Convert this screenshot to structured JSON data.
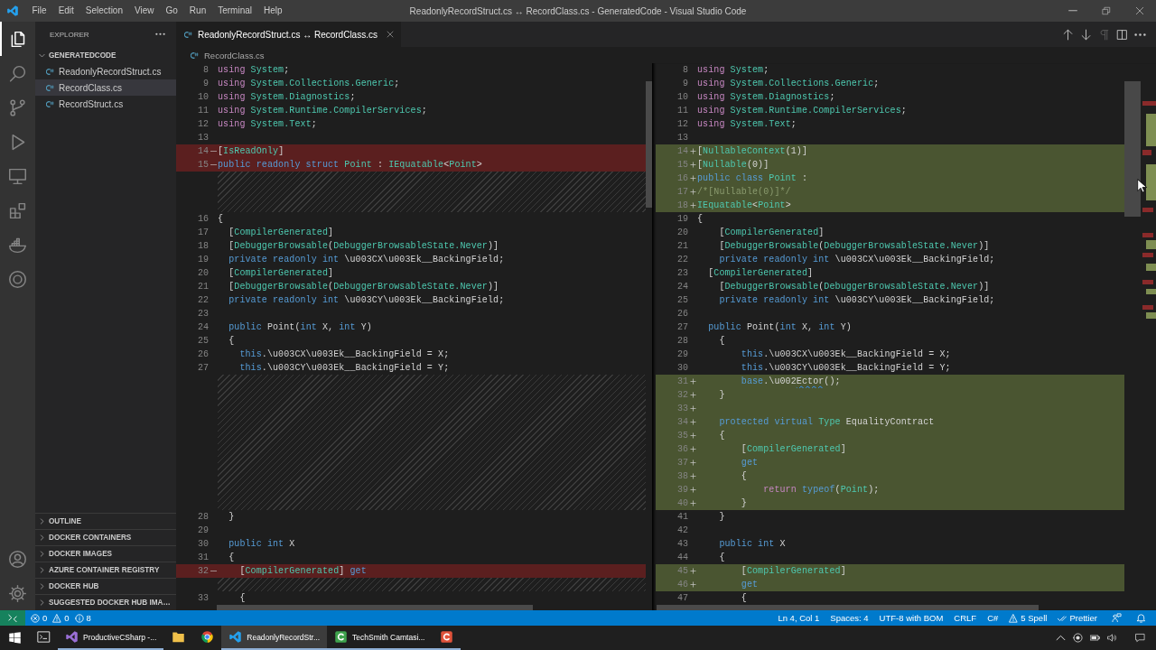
{
  "title_bar": {
    "menu": [
      "File",
      "Edit",
      "Selection",
      "View",
      "Go",
      "Run",
      "Terminal",
      "Help"
    ],
    "title": "ReadonlyRecordStruct.cs ↔ RecordClass.cs - GeneratedCode - Visual Studio Code"
  },
  "activity_bar": {
    "items": [
      {
        "kind": "files",
        "selected": true
      },
      {
        "kind": "search",
        "selected": false
      },
      {
        "kind": "source-control",
        "selected": false
      },
      {
        "kind": "run",
        "selected": false
      },
      {
        "kind": "remote",
        "selected": false
      },
      {
        "kind": "extensions",
        "selected": false
      },
      {
        "kind": "docker",
        "selected": false
      },
      {
        "kind": "ring",
        "selected": false
      }
    ]
  },
  "sidebar": {
    "title": "EXPLORER",
    "folder": {
      "name": "GENERATEDCODE",
      "expanded": true,
      "files": [
        {
          "name": "ReadonlyRecordStruct.cs",
          "selected": false
        },
        {
          "name": "RecordClass.cs",
          "selected": true
        },
        {
          "name": "RecordStruct.cs",
          "selected": false
        }
      ]
    },
    "sections": [
      {
        "name": "OUTLINE",
        "expanded": false
      },
      {
        "name": "DOCKER CONTAINERS",
        "expanded": false
      },
      {
        "name": "DOCKER IMAGES",
        "expanded": false
      },
      {
        "name": "AZURE CONTAINER REGISTRY",
        "expanded": false
      },
      {
        "name": "DOCKER HUB",
        "expanded": false
      },
      {
        "name": "SUGGESTED DOCKER HUB IMA…",
        "expanded": false
      }
    ]
  },
  "editor": {
    "tabs": [
      {
        "label": "ReadonlyRecordStruct.cs ↔ RecordClass.cs",
        "selected": true
      }
    ],
    "actions": [
      {
        "kind": "up",
        "disabled": false
      },
      {
        "kind": "down",
        "disabled": false
      },
      {
        "kind": "whitespace",
        "disabled": true
      },
      {
        "kind": "split",
        "disabled": false
      },
      {
        "kind": "more",
        "disabled": false
      }
    ],
    "breadcrumb": "RecordClass.cs",
    "panes": [
      {
        "lines": [
          {
            "number": "8",
            "kind": "unchanged",
            "tokens": [
              {
                "kind": "ctl",
                "text": "using"
              },
              {
                "kind": "type",
                "text": " System"
              },
              {
                "kind": "plain",
                "text": ";"
              }
            ]
          },
          {
            "number": "9",
            "kind": "unchanged",
            "tokens": [
              {
                "kind": "ctl",
                "text": "using"
              },
              {
                "kind": "type",
                "text": " System.Collections.Generic"
              },
              {
                "kind": "plain",
                "text": ";"
              }
            ]
          },
          {
            "number": "10",
            "kind": "unchanged",
            "tokens": [
              {
                "kind": "ctl",
                "text": "using"
              },
              {
                "kind": "type",
                "text": " System.Diagnostics"
              },
              {
                "kind": "plain",
                "text": ";"
              }
            ]
          },
          {
            "number": "11",
            "kind": "unchanged",
            "tokens": [
              {
                "kind": "ctl",
                "text": "using"
              },
              {
                "kind": "type",
                "text": " System.Runtime.CompilerServices"
              },
              {
                "kind": "plain",
                "text": ";"
              }
            ]
          },
          {
            "number": "12",
            "kind": "unchanged",
            "tokens": [
              {
                "kind": "ctl",
                "text": "using"
              },
              {
                "kind": "type",
                "text": " System.Text"
              },
              {
                "kind": "plain",
                "text": ";"
              }
            ]
          },
          {
            "number": "13",
            "kind": "unchanged"
          },
          {
            "number": "14",
            "kind": "removed",
            "tokens": [
              {
                "kind": "plain",
                "text": "["
              },
              {
                "kind": "type",
                "text": "IsReadOnly"
              },
              {
                "kind": "plain",
                "text": "]"
              }
            ]
          },
          {
            "number": "15",
            "kind": "removed",
            "tokens": [
              {
                "kind": "kw",
                "text": "public readonly struct"
              },
              {
                "kind": "type",
                "text": " Point"
              },
              {
                "kind": "plain",
                "text": " : "
              },
              {
                "kind": "type",
                "text": "IEquatable"
              },
              {
                "kind": "plain",
                "text": "<"
              },
              {
                "kind": "type",
                "text": "Point"
              },
              {
                "kind": "plain",
                "text": ">"
              }
            ]
          },
          {
            "kind": "filler"
          },
          {
            "kind": "filler"
          },
          {
            "kind": "filler"
          },
          {
            "number": "16",
            "kind": "unchanged",
            "tokens": [
              {
                "kind": "plain",
                "text": "{"
              }
            ]
          },
          {
            "number": "17",
            "kind": "unchanged",
            "tokens": [
              {
                "kind": "plain",
                "text": "  ["
              },
              {
                "kind": "type",
                "text": "CompilerGenerated"
              },
              {
                "kind": "plain",
                "text": "]"
              }
            ]
          },
          {
            "number": "18",
            "kind": "unchanged",
            "tokens": [
              {
                "kind": "plain",
                "text": "  ["
              },
              {
                "kind": "type",
                "text": "DebuggerBrowsable"
              },
              {
                "kind": "plain",
                "text": "("
              },
              {
                "kind": "type",
                "text": "DebuggerBrowsableState.Never"
              },
              {
                "kind": "plain",
                "text": ")]"
              }
            ]
          },
          {
            "number": "19",
            "kind": "unchanged",
            "tokens": [
              {
                "kind": "kw",
                "text": "  private readonly int"
              },
              {
                "kind": "plain",
                "text": " \\u003CX\\u003Ek__BackingField;"
              }
            ]
          },
          {
            "number": "20",
            "kind": "unchanged",
            "tokens": [
              {
                "kind": "plain",
                "text": "  ["
              },
              {
                "kind": "type",
                "text": "CompilerGenerated"
              },
              {
                "kind": "plain",
                "text": "]"
              }
            ]
          },
          {
            "number": "21",
            "kind": "unchanged",
            "tokens": [
              {
                "kind": "plain",
                "text": "  ["
              },
              {
                "kind": "type",
                "text": "DebuggerBrowsable"
              },
              {
                "kind": "plain",
                "text": "("
              },
              {
                "kind": "type",
                "text": "DebuggerBrowsableState.Never"
              },
              {
                "kind": "plain",
                "text": ")]"
              }
            ]
          },
          {
            "number": "22",
            "kind": "unchanged",
            "tokens": [
              {
                "kind": "kw",
                "text": "  private readonly int"
              },
              {
                "kind": "plain",
                "text": " \\u003CY\\u003Ek__BackingField;"
              }
            ]
          },
          {
            "number": "23",
            "kind": "unchanged"
          },
          {
            "number": "24",
            "kind": "unchanged",
            "tokens": [
              {
                "kind": "kw",
                "text": "  public"
              },
              {
                "kind": "plain",
                "text": " Point("
              },
              {
                "kind": "kw",
                "text": "int"
              },
              {
                "kind": "plain",
                "text": " X, "
              },
              {
                "kind": "kw",
                "text": "int"
              },
              {
                "kind": "plain",
                "text": " Y)"
              }
            ]
          },
          {
            "number": "25",
            "kind": "unchanged",
            "tokens": [
              {
                "kind": "plain",
                "text": "  {"
              }
            ]
          },
          {
            "number": "26",
            "kind": "unchanged",
            "tokens": [
              {
                "kind": "kw",
                "text": "    this"
              },
              {
                "kind": "plain",
                "text": ".\\u003CX\\u003Ek__BackingField = X;"
              }
            ]
          },
          {
            "number": "27",
            "kind": "unchanged",
            "tokens": [
              {
                "kind": "kw",
                "text": "    this"
              },
              {
                "kind": "plain",
                "text": ".\\u003CY\\u003Ek__BackingField = Y;"
              }
            ]
          },
          {
            "kind": "filler"
          },
          {
            "kind": "filler"
          },
          {
            "kind": "filler"
          },
          {
            "kind": "filler"
          },
          {
            "kind": "filler"
          },
          {
            "kind": "filler"
          },
          {
            "kind": "filler"
          },
          {
            "kind": "filler"
          },
          {
            "kind": "filler"
          },
          {
            "kind": "filler"
          },
          {
            "number": "28",
            "kind": "unchanged",
            "tokens": [
              {
                "kind": "plain",
                "text": "  }"
              }
            ]
          },
          {
            "number": "29",
            "kind": "unchanged"
          },
          {
            "number": "30",
            "kind": "unchanged",
            "tokens": [
              {
                "kind": "kw",
                "text": "  public int"
              },
              {
                "kind": "plain",
                "text": " X"
              }
            ]
          },
          {
            "number": "31",
            "kind": "unchanged",
            "tokens": [
              {
                "kind": "plain",
                "text": "  {"
              }
            ]
          },
          {
            "number": "32",
            "kind": "removed",
            "tokens": [
              {
                "kind": "plain",
                "text": "    ["
              },
              {
                "kind": "type",
                "text": "CompilerGenerated"
              },
              {
                "kind": "plain",
                "text": "] "
              },
              {
                "kind": "kw",
                "text": "get"
              }
            ]
          },
          {
            "kind": "filler"
          },
          {
            "number": "33",
            "kind": "unchanged",
            "tokens": [
              {
                "kind": "plain",
                "text": "    {"
              }
            ]
          }
        ]
      },
      {
        "lines": [
          {
            "number": "8",
            "kind": "unchanged",
            "tokens": [
              {
                "kind": "ctl",
                "text": "using"
              },
              {
                "kind": "type",
                "text": " System"
              },
              {
                "kind": "plain",
                "text": ";"
              }
            ]
          },
          {
            "number": "9",
            "kind": "unchanged",
            "tokens": [
              {
                "kind": "ctl",
                "text": "using"
              },
              {
                "kind": "type",
                "text": " System.Collections.Generic"
              },
              {
                "kind": "plain",
                "text": ";"
              }
            ]
          },
          {
            "number": "10",
            "kind": "unchanged",
            "tokens": [
              {
                "kind": "ctl",
                "text": "using"
              },
              {
                "kind": "type",
                "text": " System.Diagnostics"
              },
              {
                "kind": "plain",
                "text": ";"
              }
            ]
          },
          {
            "number": "11",
            "kind": "unchanged",
            "tokens": [
              {
                "kind": "ctl",
                "text": "using"
              },
              {
                "kind": "type",
                "text": " System.Runtime.CompilerServices"
              },
              {
                "kind": "plain",
                "text": ";"
              }
            ]
          },
          {
            "number": "12",
            "kind": "unchanged",
            "tokens": [
              {
                "kind": "ctl",
                "text": "using"
              },
              {
                "kind": "type",
                "text": " System.Text"
              },
              {
                "kind": "plain",
                "text": ";"
              }
            ]
          },
          {
            "number": "13",
            "kind": "unchanged"
          },
          {
            "number": "14",
            "kind": "added",
            "tokens": [
              {
                "kind": "plain",
                "text": "["
              },
              {
                "kind": "type",
                "text": "NullableContext"
              },
              {
                "kind": "plain",
                "text": "(1)]"
              }
            ]
          },
          {
            "number": "15",
            "kind": "added",
            "tokens": [
              {
                "kind": "plain",
                "text": "["
              },
              {
                "kind": "type",
                "text": "Nullable"
              },
              {
                "kind": "plain",
                "text": "(0)]"
              }
            ]
          },
          {
            "number": "16",
            "kind": "added",
            "tokens": [
              {
                "kind": "kw",
                "text": "public class"
              },
              {
                "kind": "type",
                "text": " Point"
              },
              {
                "kind": "plain",
                "text": " :"
              }
            ]
          },
          {
            "number": "17",
            "kind": "added",
            "tokens": [
              {
                "kind": "comment",
                "text": "/*[Nullable(0)]*/"
              }
            ]
          },
          {
            "number": "18",
            "kind": "added",
            "tokens": [
              {
                "kind": "type",
                "text": "IEquatable"
              },
              {
                "kind": "plain",
                "text": "<"
              },
              {
                "kind": "type",
                "text": "Point"
              },
              {
                "kind": "plain",
                "text": ">"
              }
            ]
          },
          {
            "number": "19",
            "kind": "unchanged",
            "tokens": [
              {
                "kind": "plain",
                "text": "{"
              }
            ]
          },
          {
            "number": "20",
            "kind": "unchanged",
            "tokens": [
              {
                "kind": "plain",
                "text": "    ["
              },
              {
                "kind": "type",
                "text": "CompilerGenerated"
              },
              {
                "kind": "plain",
                "text": "]"
              }
            ]
          },
          {
            "number": "21",
            "kind": "unchanged",
            "tokens": [
              {
                "kind": "plain",
                "text": "    ["
              },
              {
                "kind": "type",
                "text": "DebuggerBrowsable"
              },
              {
                "kind": "plain",
                "text": "("
              },
              {
                "kind": "type",
                "text": "DebuggerBrowsableState.Never"
              },
              {
                "kind": "plain",
                "text": ")]"
              }
            ]
          },
          {
            "number": "22",
            "kind": "unchanged",
            "tokens": [
              {
                "kind": "kw",
                "text": "    private readonly int"
              },
              {
                "kind": "plain",
                "text": " \\u003CX\\u003Ek__BackingField;"
              }
            ]
          },
          {
            "number": "23",
            "kind": "unchanged",
            "tokens": [
              {
                "kind": "plain",
                "text": "  ["
              },
              {
                "kind": "type",
                "text": "CompilerGenerated"
              },
              {
                "kind": "plain",
                "text": "]"
              }
            ]
          },
          {
            "number": "24",
            "kind": "unchanged",
            "tokens": [
              {
                "kind": "plain",
                "text": "    ["
              },
              {
                "kind": "type",
                "text": "DebuggerBrowsable"
              },
              {
                "kind": "plain",
                "text": "("
              },
              {
                "kind": "type",
                "text": "DebuggerBrowsableState.Never"
              },
              {
                "kind": "plain",
                "text": ")]"
              }
            ]
          },
          {
            "number": "25",
            "kind": "unchanged",
            "tokens": [
              {
                "kind": "kw",
                "text": "    private readonly int"
              },
              {
                "kind": "plain",
                "text": " \\u003CY\\u003Ek__BackingField;"
              }
            ]
          },
          {
            "number": "26",
            "kind": "unchanged"
          },
          {
            "number": "27",
            "kind": "unchanged",
            "tokens": [
              {
                "kind": "kw",
                "text": "  public"
              },
              {
                "kind": "plain",
                "text": " Point("
              },
              {
                "kind": "kw",
                "text": "int"
              },
              {
                "kind": "plain",
                "text": " X, "
              },
              {
                "kind": "kw",
                "text": "int"
              },
              {
                "kind": "plain",
                "text": " Y)"
              }
            ]
          },
          {
            "number": "28",
            "kind": "unchanged",
            "tokens": [
              {
                "kind": "plain",
                "text": "    {"
              }
            ]
          },
          {
            "number": "29",
            "kind": "unchanged",
            "tokens": [
              {
                "kind": "kw",
                "text": "        this"
              },
              {
                "kind": "plain",
                "text": ".\\u003CX\\u003Ek__BackingField = X;"
              }
            ]
          },
          {
            "number": "30",
            "kind": "unchanged",
            "tokens": [
              {
                "kind": "kw",
                "text": "        this"
              },
              {
                "kind": "plain",
                "text": ".\\u003CY\\u003Ek__BackingField = Y;"
              }
            ]
          },
          {
            "number": "31",
            "kind": "added",
            "tokens": [
              {
                "kind": "kw",
                "text": "        base"
              },
              {
                "kind": "plain",
                "text": ".\\u002"
              },
              {
                "kind": "spell",
                "text": "Ector"
              },
              {
                "kind": "plain",
                "text": "();"
              }
            ]
          },
          {
            "number": "32",
            "kind": "added",
            "tokens": [
              {
                "kind": "plain",
                "text": "    }"
              }
            ]
          },
          {
            "number": "33",
            "kind": "added"
          },
          {
            "number": "34",
            "kind": "added",
            "tokens": [
              {
                "kind": "kw",
                "text": "    protected virtual"
              },
              {
                "kind": "type",
                "text": " Type"
              },
              {
                "kind": "plain",
                "text": " EqualityContract"
              }
            ]
          },
          {
            "number": "35",
            "kind": "added",
            "tokens": [
              {
                "kind": "plain",
                "text": "    {"
              }
            ]
          },
          {
            "number": "36",
            "kind": "added",
            "tokens": [
              {
                "kind": "plain",
                "text": "        ["
              },
              {
                "kind": "type",
                "text": "CompilerGenerated"
              },
              {
                "kind": "plain",
                "text": "]"
              }
            ]
          },
          {
            "number": "37",
            "kind": "added",
            "tokens": [
              {
                "kind": "kw",
                "text": "        get"
              }
            ]
          },
          {
            "number": "38",
            "kind": "added",
            "tokens": [
              {
                "kind": "plain",
                "text": "        {"
              }
            ]
          },
          {
            "number": "39",
            "kind": "added",
            "tokens": [
              {
                "kind": "ctl",
                "text": "            return"
              },
              {
                "kind": "kw",
                "text": " typeof"
              },
              {
                "kind": "plain",
                "text": "("
              },
              {
                "kind": "type",
                "text": "Point"
              },
              {
                "kind": "plain",
                "text": ");"
              }
            ]
          },
          {
            "number": "40",
            "kind": "added",
            "tokens": [
              {
                "kind": "plain",
                "text": "        }"
              }
            ]
          },
          {
            "number": "41",
            "kind": "unchanged",
            "tokens": [
              {
                "kind": "plain",
                "text": "    }"
              }
            ]
          },
          {
            "number": "42",
            "kind": "unchanged"
          },
          {
            "number": "43",
            "kind": "unchanged",
            "tokens": [
              {
                "kind": "kw",
                "text": "    public int"
              },
              {
                "kind": "plain",
                "text": " X"
              }
            ]
          },
          {
            "number": "44",
            "kind": "unchanged",
            "tokens": [
              {
                "kind": "plain",
                "text": "    {"
              }
            ]
          },
          {
            "number": "45",
            "kind": "added",
            "tokens": [
              {
                "kind": "plain",
                "text": "        ["
              },
              {
                "kind": "type",
                "text": "CompilerGenerated"
              },
              {
                "kind": "plain",
                "text": "]"
              }
            ]
          },
          {
            "number": "46",
            "kind": "added",
            "tokens": [
              {
                "kind": "kw",
                "text": "        get"
              }
            ]
          },
          {
            "number": "47",
            "kind": "unchanged",
            "tokens": [
              {
                "kind": "plain",
                "text": "        {"
              }
            ]
          }
        ]
      }
    ]
  },
  "status_bar": {
    "problems": [
      {
        "kind": "error",
        "count": "0"
      },
      {
        "kind": "warning",
        "count": "0"
      },
      {
        "kind": "info",
        "count": "8"
      }
    ],
    "items": [
      {
        "kind": "text",
        "text": "Ln 4, Col 1"
      },
      {
        "kind": "text",
        "text": "Spaces: 4"
      },
      {
        "kind": "text",
        "text": "UTF-8 with BOM"
      },
      {
        "kind": "text",
        "text": "CRLF"
      },
      {
        "kind": "text",
        "text": "C#"
      },
      {
        "kind": "warning",
        "text": "5 Spell"
      },
      {
        "kind": "check",
        "text": "Prettier"
      },
      {
        "kind": "feedback"
      },
      {
        "kind": "bell"
      }
    ]
  },
  "taskbar": {
    "apps": [
      {
        "kind": "terminal",
        "running": false,
        "selected": false
      },
      {
        "kind": "ide",
        "label": "ProductiveCSharp -...",
        "running": true,
        "selected": false
      },
      {
        "kind": "folder",
        "running": false,
        "selected": false
      },
      {
        "kind": "browser",
        "running": false,
        "selected": false
      },
      {
        "kind": "editor",
        "label": "ReadonlyRecordStr...",
        "running": true,
        "selected": true
      },
      {
        "kind": "recorder",
        "label": "TechSmith Camtasi...",
        "running": true,
        "selected": false
      },
      {
        "kind": "recorder-alt",
        "running": true,
        "selected": false
      }
    ]
  }
}
